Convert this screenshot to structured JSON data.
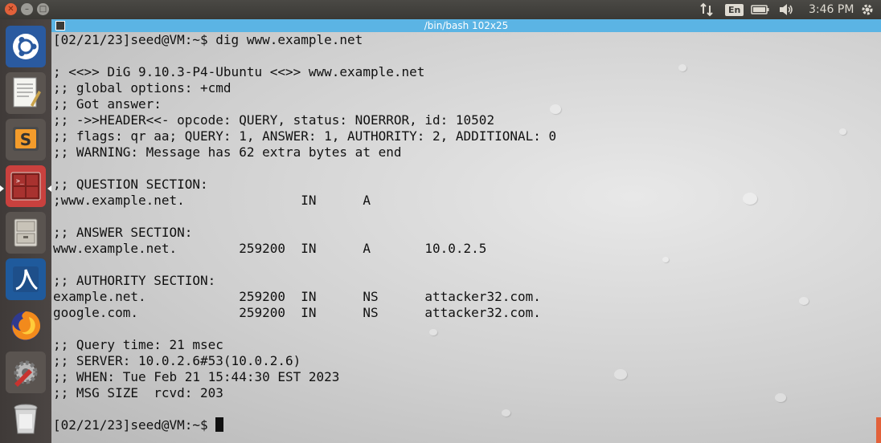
{
  "terminal": {
    "title": "/bin/bash 102x25",
    "lines": [
      "[02/21/23]seed@VM:~$ dig www.example.net",
      "",
      "; <<>> DiG 9.10.3-P4-Ubuntu <<>> www.example.net",
      ";; global options: +cmd",
      ";; Got answer:",
      ";; ->>HEADER<<- opcode: QUERY, status: NOERROR, id: 10502",
      ";; flags: qr aa; QUERY: 1, ANSWER: 1, AUTHORITY: 2, ADDITIONAL: 0",
      ";; WARNING: Message has 62 extra bytes at end",
      "",
      ";; QUESTION SECTION:",
      ";www.example.net.               IN      A",
      "",
      ";; ANSWER SECTION:",
      "www.example.net.        259200  IN      A       10.0.2.5",
      "",
      ";; AUTHORITY SECTION:",
      "example.net.            259200  IN      NS      attacker32.com.",
      "google.com.             259200  IN      NS      attacker32.com.",
      "",
      ";; Query time: 21 msec",
      ";; SERVER: 10.0.2.6#53(10.0.2.6)",
      ";; WHEN: Tue Feb 21 15:44:30 EST 2023",
      ";; MSG SIZE  rcvd: 203",
      ""
    ],
    "prompt": "[02/21/23]seed@VM:~$ "
  },
  "topbar": {
    "keyboard_lang": "En",
    "clock": "3:46 PM",
    "icons": [
      "network-updown-icon",
      "keyboard-lang-icon",
      "battery-icon",
      "volume-icon",
      "settings-gear-icon"
    ]
  },
  "window_controls": [
    "close",
    "minimize",
    "maximize"
  ],
  "launcher": {
    "items": [
      "ubuntu-dash",
      "text-editor",
      "sublime-text",
      "terminal",
      "file-manager",
      "wireshark",
      "firefox",
      "system-settings",
      "trash"
    ],
    "active": "terminal"
  },
  "colors": {
    "titlebar": "#5bb4e4",
    "panel": "#3c3b37",
    "terminal_text": "#111111"
  }
}
